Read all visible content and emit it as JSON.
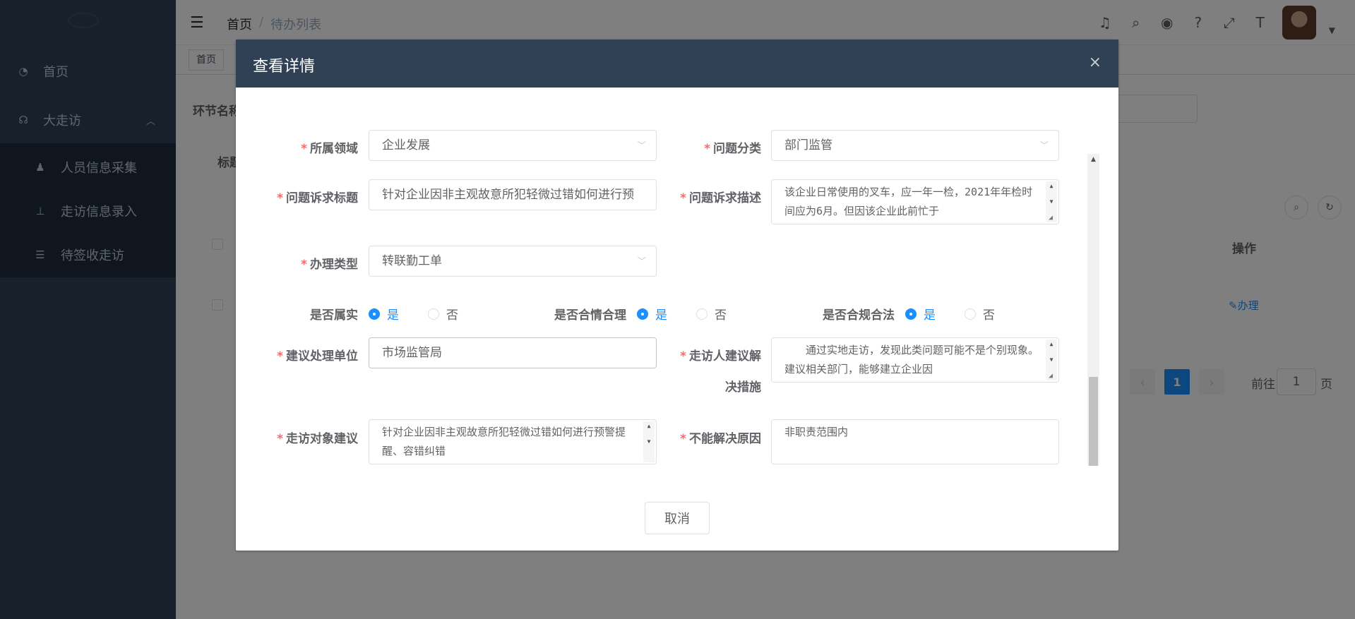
{
  "sidebar": {
    "items": [
      {
        "label": "首页",
        "icon": "dashboard-icon"
      },
      {
        "label": "大走访",
        "icon": "visit-icon"
      }
    ],
    "sub_items": [
      {
        "label": "人员信息采集",
        "icon": "people-icon"
      },
      {
        "label": "走访信息录入",
        "icon": "tree-icon"
      },
      {
        "label": "待签收走访",
        "icon": "list-icon"
      }
    ]
  },
  "navbar": {
    "breadcrumb_home": "首页",
    "breadcrumb_sep": "/",
    "breadcrumb_current": "待办列表",
    "icons": [
      "bell-icon",
      "search-icon",
      "github-icon",
      "question-icon",
      "fullscreen-icon",
      "font-size-icon"
    ]
  },
  "tags": {
    "active": "首页"
  },
  "background": {
    "label_stage": "环节名称",
    "label_title": "标题",
    "col_action": "操作",
    "action_link": "✎办理",
    "pager_current": "1",
    "goto_label": "前往",
    "goto_value": "1",
    "page_suffix": "页"
  },
  "dialog": {
    "title": "查看详情",
    "close": "×",
    "fields": {
      "domain": {
        "label": "所属领域",
        "value": "企业发展"
      },
      "category": {
        "label": "问题分类",
        "value": "部门监管"
      },
      "issue_title": {
        "label": "问题诉求标题",
        "value": "针对企业因非主观故意所犯轻微过错如何进行预"
      },
      "issue_desc": {
        "label": "问题诉求描述",
        "value": "该企业日常使用的叉车，应一年一检，2021年年检时间应为6月。但因该企业此前忙于"
      },
      "handle_type": {
        "label": "办理类型",
        "value": "转联勤工单"
      },
      "is_true": {
        "label": "是否属实",
        "yes": "是",
        "no": "否",
        "selected": "是"
      },
      "is_reasonable": {
        "label": "是否合情合理",
        "yes": "是",
        "no": "否",
        "selected": "是"
      },
      "is_legal": {
        "label": "是否合规合法",
        "yes": "是",
        "no": "否",
        "selected": "是"
      },
      "suggest_unit": {
        "label": "建议处理单位",
        "value": "市场监管局"
      },
      "visitor_suggest": {
        "label_line1": "走访人建议解",
        "label_line2": "决措施",
        "value": "　　通过实地走访，发现此类问题可能不是个别现象。建议相关部门，能够建立企业因"
      },
      "target_suggest": {
        "label": "走访对象建议",
        "value": "针对企业因非主观故意所犯轻微过错如何进行预警提醒、容错纠错"
      },
      "unresolved_reason": {
        "label": "不能解决原因",
        "value": "非职责范围内"
      }
    },
    "cancel_label": "取消"
  }
}
